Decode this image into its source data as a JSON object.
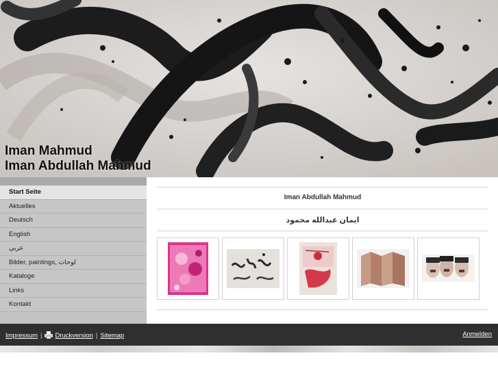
{
  "header": {
    "title_line1": "Iman Mahmud",
    "title_line2": "Iman Abdullah Mahmud"
  },
  "sidebar": {
    "items": [
      {
        "label": "Start Seite",
        "active": true
      },
      {
        "label": "Aktuelles"
      },
      {
        "label": "Deutsch"
      },
      {
        "label": "English"
      },
      {
        "label": "عربي"
      },
      {
        "label": "Bilder, paintings, لوحات"
      },
      {
        "label": "Kataloge"
      },
      {
        "label": "Links"
      },
      {
        "label": "Kontakt"
      }
    ]
  },
  "main": {
    "heading_latin": "Iman Abdullah Mahmud",
    "heading_arabic": "ايمان عبدالله محمود",
    "thumbnails": [
      {
        "icon": "pink-painting-thumbnail"
      },
      {
        "icon": "calligraphy-thumbnail"
      },
      {
        "icon": "red-painting-thumbnail"
      },
      {
        "icon": "folded-book-thumbnail"
      },
      {
        "icon": "faces-thumbnail"
      }
    ]
  },
  "footer": {
    "impressum": "Impressum",
    "separator": "|",
    "druckversion": "Druckversion",
    "sitemap": "Sitemap",
    "login": "Anmelden"
  }
}
